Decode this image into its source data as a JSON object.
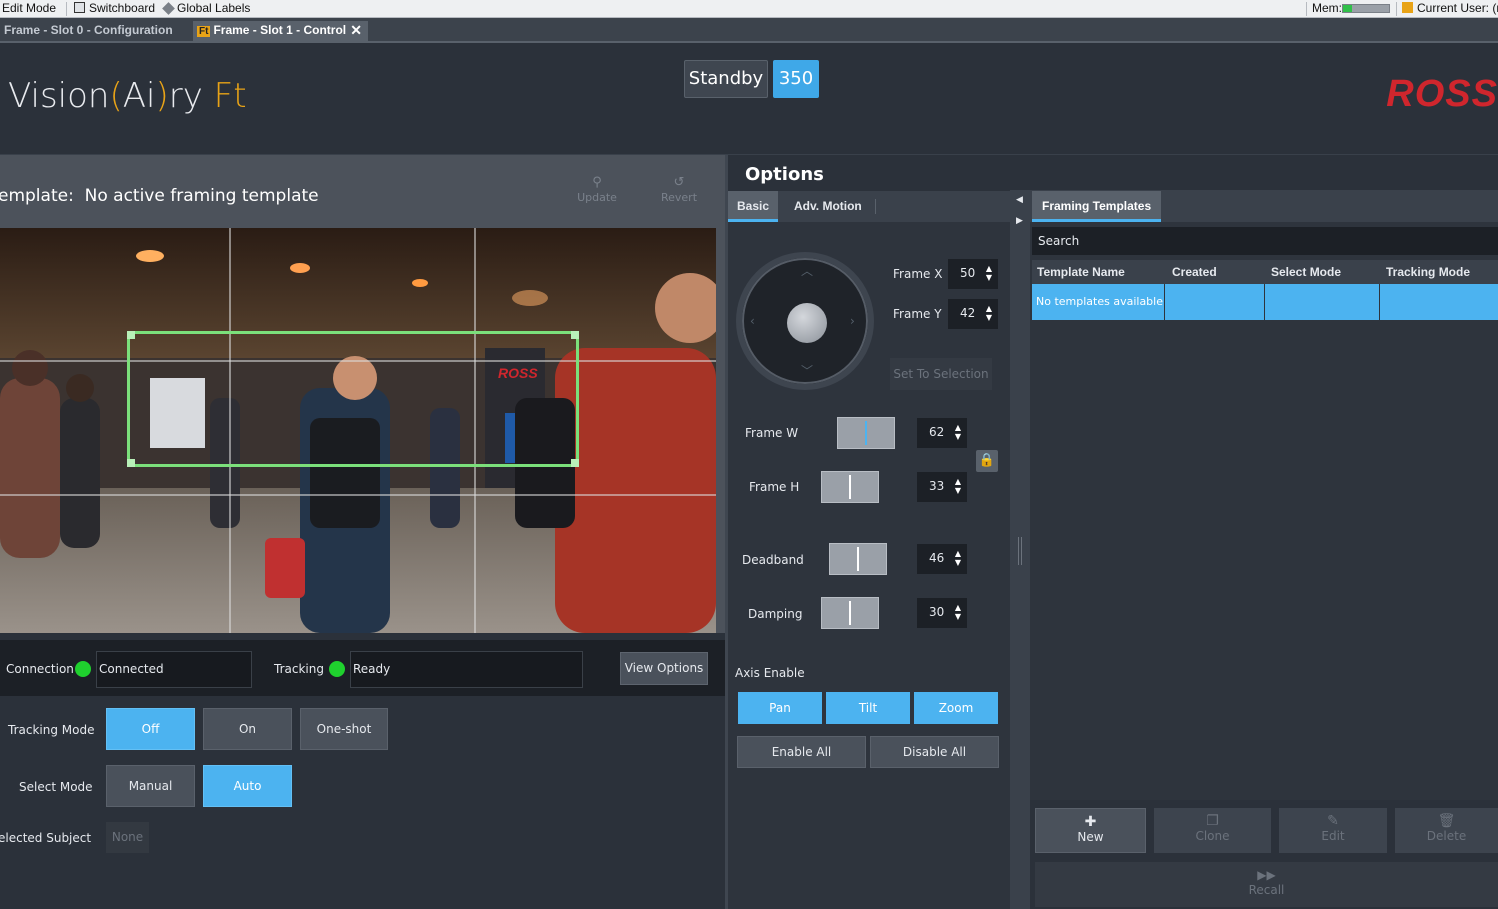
{
  "sysbar": {
    "edit_mode": "Edit Mode",
    "switchboard": "Switchboard",
    "global_labels": "Global Labels",
    "mem_label": "Mem:",
    "mem_level": 0.2,
    "current_user": "Current User: (n"
  },
  "window_tabs": [
    {
      "label": "Frame - Slot 0 - Configuration",
      "active": false
    },
    {
      "label": "Frame - Slot 1 - Control",
      "badge": "Ft",
      "active": true
    }
  ],
  "header": {
    "logo_pre": "Vision",
    "logo_mid": "Ai",
    "logo_post": "ry",
    "logo_ft": "Ft",
    "standby_label": "Standby",
    "standby_value": "350",
    "brand": "ROSS",
    "accent": "#4cb3f0",
    "brand_color": "#d0262d"
  },
  "template_bar": {
    "label": "emplate:",
    "value": "No active framing template",
    "update_label": "Update",
    "revert_label": "Revert"
  },
  "status": {
    "connection_label": "Connection",
    "connection_value": "Connected",
    "tracking_label": "Tracking",
    "tracking_value": "Ready",
    "view_options": "View Options",
    "led_color": "#1fd12e"
  },
  "tracking_mode": {
    "label": "Tracking Mode",
    "options": [
      "Off",
      "On",
      "One-shot"
    ],
    "selected": "Off"
  },
  "select_mode": {
    "label": "Select Mode",
    "options": [
      "Manual",
      "Auto"
    ],
    "selected": "Auto"
  },
  "selected_subject": {
    "label": "elected Subject",
    "value": "None"
  },
  "options": {
    "title": "Options",
    "tabs": [
      "Basic",
      "Adv. Motion"
    ],
    "active_tab": "Basic",
    "frame_x_label": "Frame X",
    "frame_x": "50",
    "frame_y_label": "Frame Y",
    "frame_y": "42",
    "set_to_selection": "Set To Selection",
    "frame_w_label": "Frame W",
    "frame_w": "62",
    "frame_h_label": "Frame H",
    "frame_h": "33",
    "deadband_label": "Deadband",
    "deadband": "46",
    "damping_label": "Damping",
    "damping": "30",
    "axis_enable_label": "Axis Enable",
    "axis_buttons": [
      "Pan",
      "Tilt",
      "Zoom"
    ],
    "enable_all": "Enable All",
    "disable_all": "Disable All"
  },
  "templates": {
    "tab": "Framing Templates",
    "search": "Search",
    "columns": [
      "Template Name",
      "Created",
      "Select Mode",
      "Tracking Mode"
    ],
    "empty_row": "No templates available",
    "new": "New",
    "clone": "Clone",
    "edit": "Edit",
    "delete": "Delete",
    "recall": "Recall"
  },
  "icons": {
    "update": "pin-icon",
    "revert": "undo-icon",
    "lock": "lock-icon",
    "new": "plus-icon",
    "clone": "copy-icon",
    "edit": "pencil-icon",
    "delete": "trash-icon",
    "recall": "fast-forward-icon"
  }
}
